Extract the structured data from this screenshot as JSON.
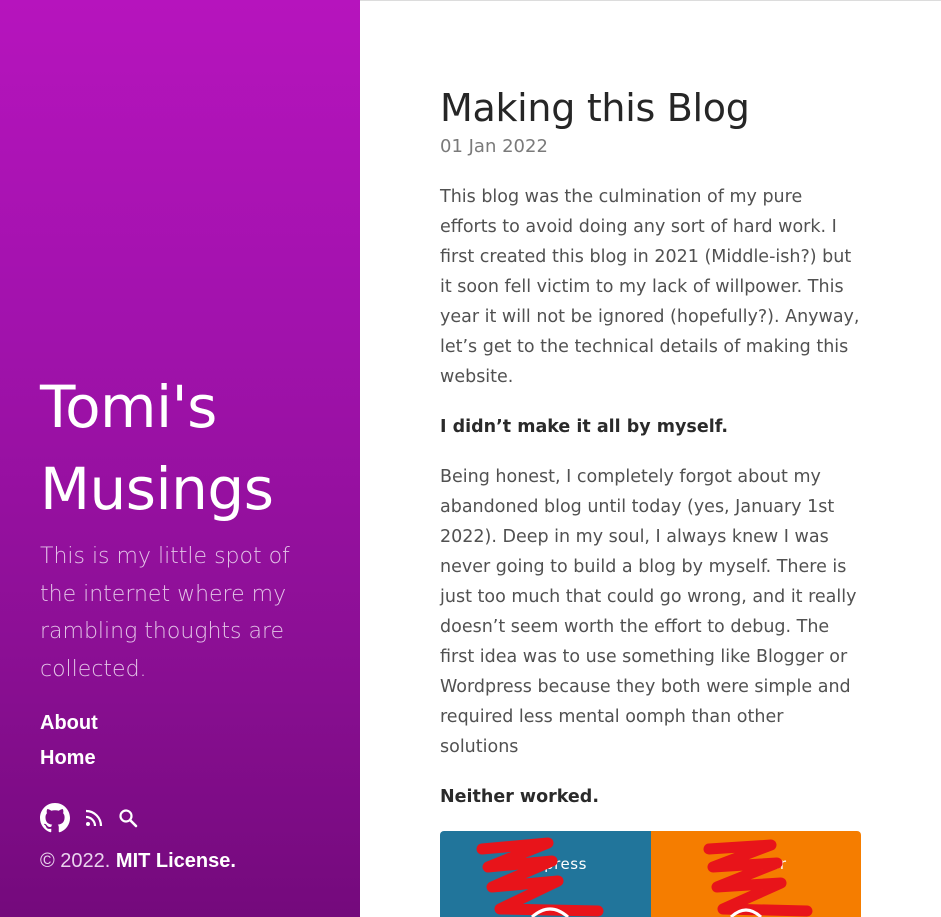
{
  "sidebar": {
    "title_line1": "Tomi's",
    "title_line2": "Musings",
    "tagline": "This is my little spot of the internet where my rambling thoughts are collected.",
    "nav": [
      {
        "label": "About"
      },
      {
        "label": "Home"
      }
    ],
    "social_icons": [
      "github-icon",
      "rss-icon",
      "search-icon"
    ],
    "copyright_prefix": "© 2022.",
    "license_label": "MIT License."
  },
  "post": {
    "title": "Making this Blog",
    "date": "01 Jan 2022",
    "paragraphs": [
      "This blog was the culmination of my pure efforts to avoid doing any sort of hard work. I first created this blog in 2021 (Middle-ish?) but it soon fell victim to my lack of willpower. This year it will not be ignored (hopefully?). Anyway, let’s get to the technical details of making this website.",
      "I didn’t make it all by myself.",
      "Being honest, I completely forgot about my abandoned blog until today (yes, January 1st 2022). Deep in my soul, I always knew I was never going to build a blog by myself. There is just too much that could go wrong, and it really doesn’t seem worth the effort to debug. The first idea was to use something like Blogger or Wordpress because they both were simple and required less mental oomph than other solutions",
      "Neither worked."
    ],
    "figure": {
      "left_label": "Wordpress",
      "right_label": "Blogger"
    }
  },
  "colors": {
    "sidebar_top": "#b614bd",
    "sidebar_bottom": "#740a7c",
    "wordpress_blue": "#21759b",
    "blogger_orange": "#f57d00",
    "scribble_red": "#e8141a"
  }
}
